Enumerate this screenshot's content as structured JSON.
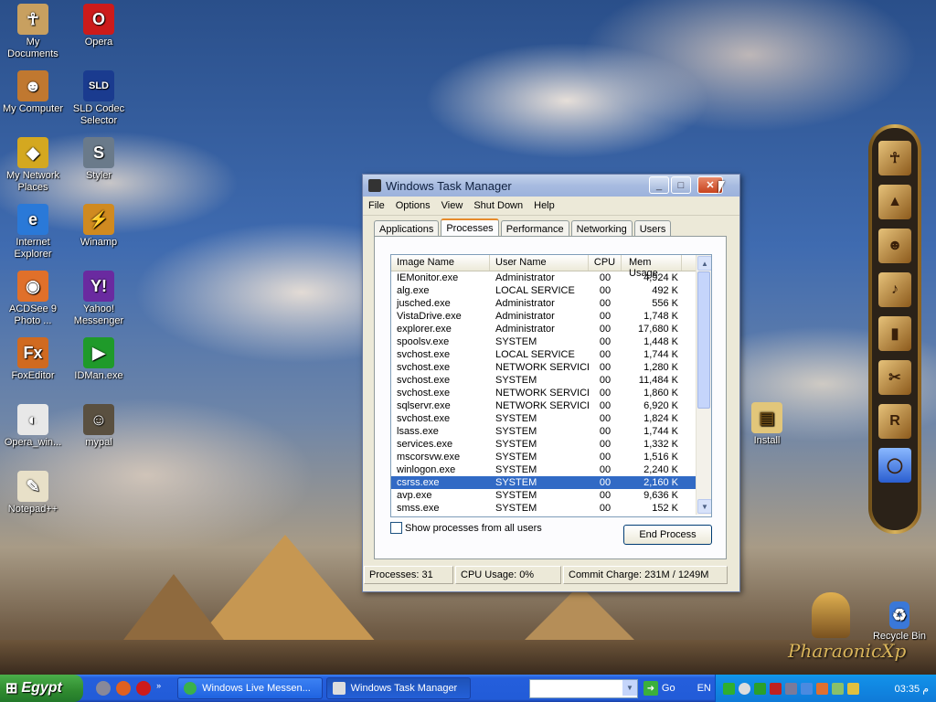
{
  "desktop": {
    "icons": [
      {
        "label": "My Documents",
        "icon": "my-documents-icon",
        "color": "#c8a060",
        "glyph": "☥"
      },
      {
        "label": "Opera",
        "icon": "opera-icon",
        "color": "#cc1b1b",
        "glyph": "O"
      },
      {
        "label": "My Computer",
        "icon": "my-computer-icon",
        "color": "#c07830",
        "glyph": "☻"
      },
      {
        "label": "SLD Codec Selector",
        "icon": "sld-codec-icon",
        "color": "#1a3b8f",
        "glyph": "SLD"
      },
      {
        "label": "My Network Places",
        "icon": "network-places-icon",
        "color": "#d4a820",
        "glyph": "◆"
      },
      {
        "label": "Styler",
        "icon": "styler-icon",
        "color": "#6a7a8a",
        "glyph": "S"
      },
      {
        "label": "Internet Explorer",
        "icon": "internet-explorer-icon",
        "color": "#2a79d8",
        "glyph": "e"
      },
      {
        "label": "Winamp",
        "icon": "winamp-icon",
        "color": "#d08a20",
        "glyph": "⚡"
      },
      {
        "label": "ACDSee 9 Photo ...",
        "icon": "acdsee-icon",
        "color": "#e0702a",
        "glyph": "◉"
      },
      {
        "label": "Yahoo! Messenger",
        "icon": "yahoo-messenger-icon",
        "color": "#6a2aa0",
        "glyph": "Y!"
      },
      {
        "label": "FoxEditor",
        "icon": "foxeditor-icon",
        "color": "#d06a20",
        "glyph": "Fx"
      },
      {
        "label": "IDMan.exe",
        "icon": "idman-icon",
        "color": "#1f9a2a",
        "glyph": "▶"
      },
      {
        "label": "Opera_win...",
        "icon": "opera-installer-icon",
        "color": "#e8e8e8",
        "glyph": "◐"
      },
      {
        "label": "mypal",
        "icon": "mypal-icon",
        "color": "#5a5040",
        "glyph": "☺"
      },
      {
        "label": "Notepad++",
        "icon": "notepadpp-icon",
        "color": "#e8e0c8",
        "glyph": "✎"
      }
    ],
    "install_label": "Install",
    "recycle_bin_label": "Recycle Bin",
    "brand_logo_text": "PharaonicXp"
  },
  "task_manager": {
    "title": "Windows Task Manager",
    "title_buttons": {
      "minimize": "_",
      "maximize": "□",
      "close": "✕"
    },
    "menu": [
      "File",
      "Options",
      "View",
      "Shut Down",
      "Help"
    ],
    "tabs": [
      "Applications",
      "Processes",
      "Performance",
      "Networking",
      "Users"
    ],
    "active_tab": "Processes",
    "columns": [
      "Image Name",
      "User Name",
      "CPU",
      "Mem Usage"
    ],
    "processes": [
      [
        "IEMonitor.exe",
        "Administrator",
        "00",
        "4,924 K"
      ],
      [
        "alg.exe",
        "LOCAL SERVICE",
        "00",
        "492 K"
      ],
      [
        "jusched.exe",
        "Administrator",
        "00",
        "556 K"
      ],
      [
        "VistaDrive.exe",
        "Administrator",
        "00",
        "1,748 K"
      ],
      [
        "explorer.exe",
        "Administrator",
        "00",
        "17,680 K"
      ],
      [
        "spoolsv.exe",
        "SYSTEM",
        "00",
        "1,448 K"
      ],
      [
        "svchost.exe",
        "LOCAL SERVICE",
        "00",
        "1,744 K"
      ],
      [
        "svchost.exe",
        "NETWORK SERVICE",
        "00",
        "1,280 K"
      ],
      [
        "svchost.exe",
        "SYSTEM",
        "00",
        "11,484 K"
      ],
      [
        "svchost.exe",
        "NETWORK SERVICE",
        "00",
        "1,860 K"
      ],
      [
        "sqlservr.exe",
        "NETWORK SERVICE",
        "00",
        "6,920 K"
      ],
      [
        "svchost.exe",
        "SYSTEM",
        "00",
        "1,824 K"
      ],
      [
        "lsass.exe",
        "SYSTEM",
        "00",
        "1,744 K"
      ],
      [
        "services.exe",
        "SYSTEM",
        "00",
        "1,332 K"
      ],
      [
        "mscorsvw.exe",
        "SYSTEM",
        "00",
        "1,516 K"
      ],
      [
        "winlogon.exe",
        "SYSTEM",
        "00",
        "2,240 K"
      ],
      [
        "csrss.exe",
        "SYSTEM",
        "00",
        "2,160 K"
      ],
      [
        "avp.exe",
        "SYSTEM",
        "00",
        "9,636 K"
      ],
      [
        "smss.exe",
        "SYSTEM",
        "00",
        "152 K"
      ]
    ],
    "selected_process": "csrss.exe",
    "show_all_label": "Show processes from all users",
    "end_process_label": "End Process",
    "status": {
      "processes": "Processes: 31",
      "cpu": "CPU Usage: 0%",
      "commit": "Commit Charge: 231M / 1249M"
    }
  },
  "taskbar": {
    "start_label": "Egypt",
    "windows": [
      {
        "label": "Windows Live Messen...",
        "icon": "messenger-icon",
        "active": false
      },
      {
        "label": "Windows Task Manager",
        "icon": "task-manager-icon",
        "active": true
      }
    ],
    "address_value": "",
    "go_label": "Go",
    "language": "EN",
    "clock": "03:35 م"
  },
  "colors": {
    "selection": "#316ac5",
    "taskbar": "#245edc",
    "start": "#2f8a2f"
  }
}
